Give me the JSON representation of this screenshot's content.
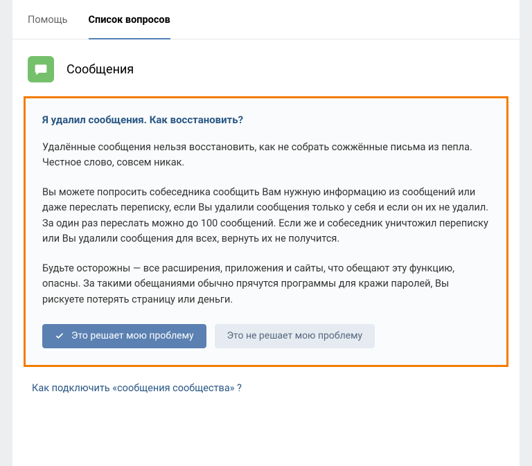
{
  "tabs": {
    "help": "Помощь",
    "questions": "Список вопросов"
  },
  "section": {
    "title": "Сообщения",
    "icon": "message-icon"
  },
  "answer": {
    "title": "Я удалил сообщения. Как восстановить?",
    "p1": "Удалённые сообщения нельзя восстановить, как не собрать сожжённые письма из пепла. Честное слово, совсем никак.",
    "p2": "Вы можете попросить собеседника сообщить Вам нужную информацию из сообщений или даже переслать переписку, если Вы удалили сообщения только у себя и если он их не удалил. За один раз переслать можно до 100 сообщений. Если же и собеседник уничтожил переписку или Вы удалили сообщения для всех, вернуть их не получится.",
    "p3": "Будьте осторожны — все расширения, приложения и сайты, что обещают эту функцию, опасны. За такими обещаниями обычно прячутся программы для кражи паролей, Вы рискуете потерять страницу или деньги."
  },
  "buttons": {
    "solves": "Это решает мою проблему",
    "not_solves": "Это не решает мою проблему"
  },
  "related": {
    "link1": "Как подключить «сообщения сообщества» ?"
  }
}
